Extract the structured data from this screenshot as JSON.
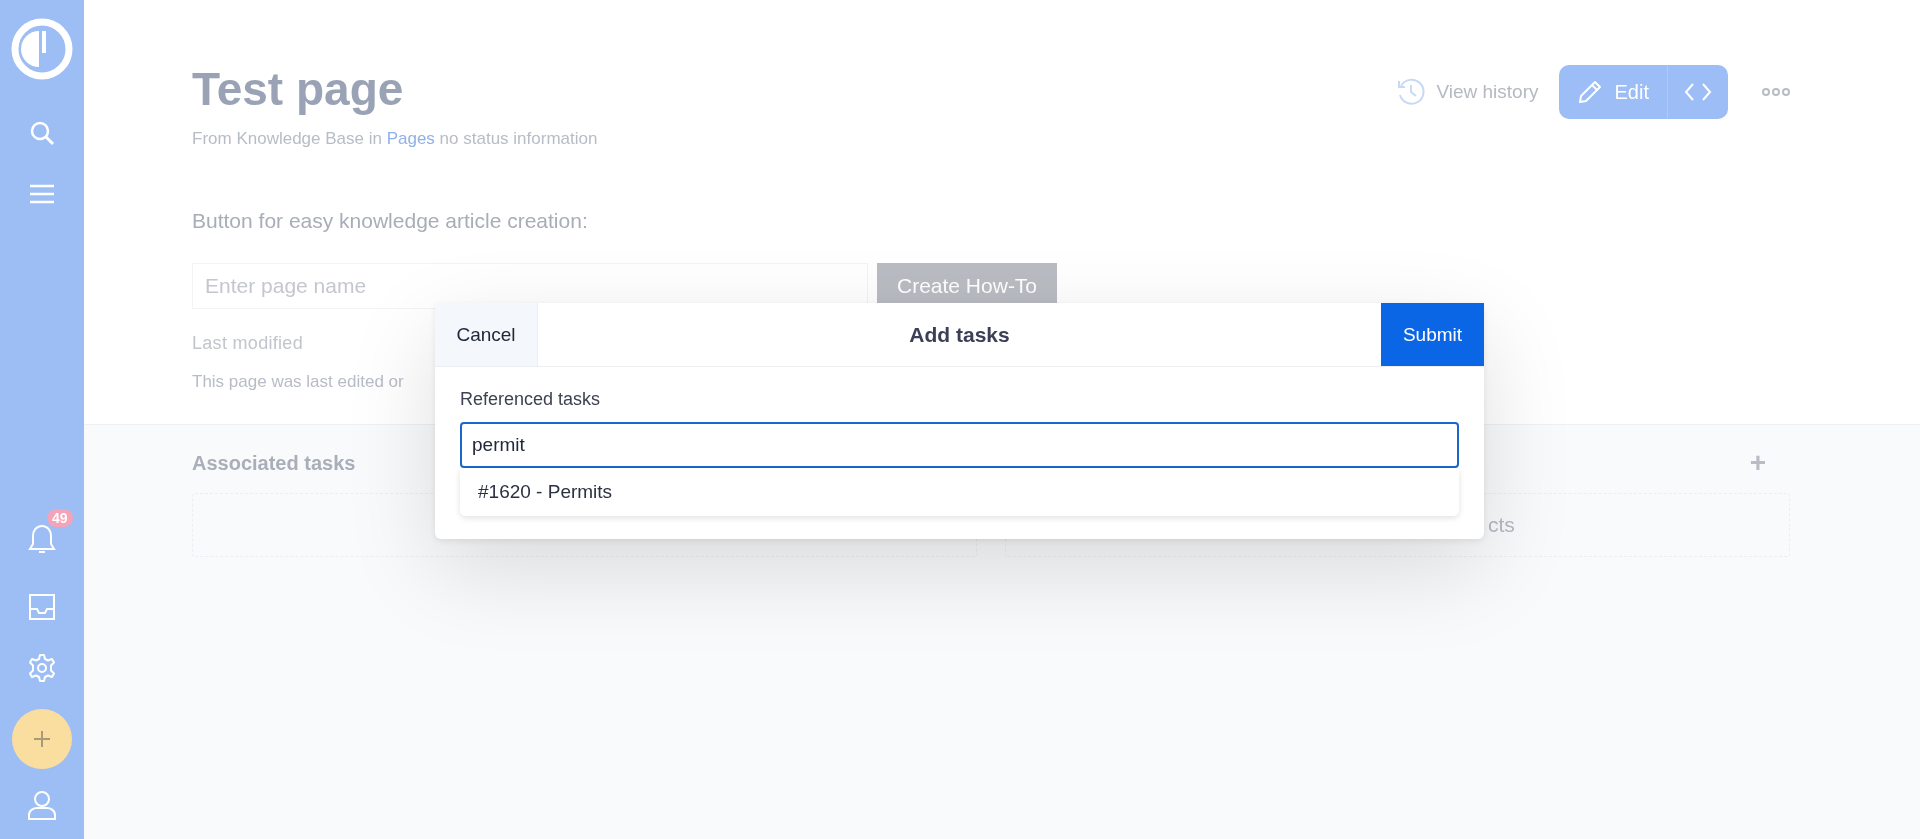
{
  "sidebar": {
    "notification_badge": "49"
  },
  "page": {
    "title": "Test page",
    "subtitle": {
      "prefix": "From Knowledge Base in",
      "link": "Pages",
      "suffix": "no status information"
    },
    "actions": {
      "view_history": "View history",
      "edit": "Edit"
    },
    "intro": "Button for easy knowledge article creation:",
    "page_name_field": {
      "placeholder": "Enter page name"
    },
    "create_button": "Create How-To",
    "last_modified_label": "Last modified",
    "last_modified_text": "This page was last edited or",
    "associated_tasks": {
      "title": "Associated tasks",
      "add": "+"
    },
    "related_box_text": "cts"
  },
  "dialog": {
    "cancel": "Cancel",
    "title": "Add tasks",
    "submit": "Submit",
    "field_label": "Referenced tasks",
    "field_value": "permit",
    "suggestions": [
      "#1620 - Permits"
    ]
  }
}
